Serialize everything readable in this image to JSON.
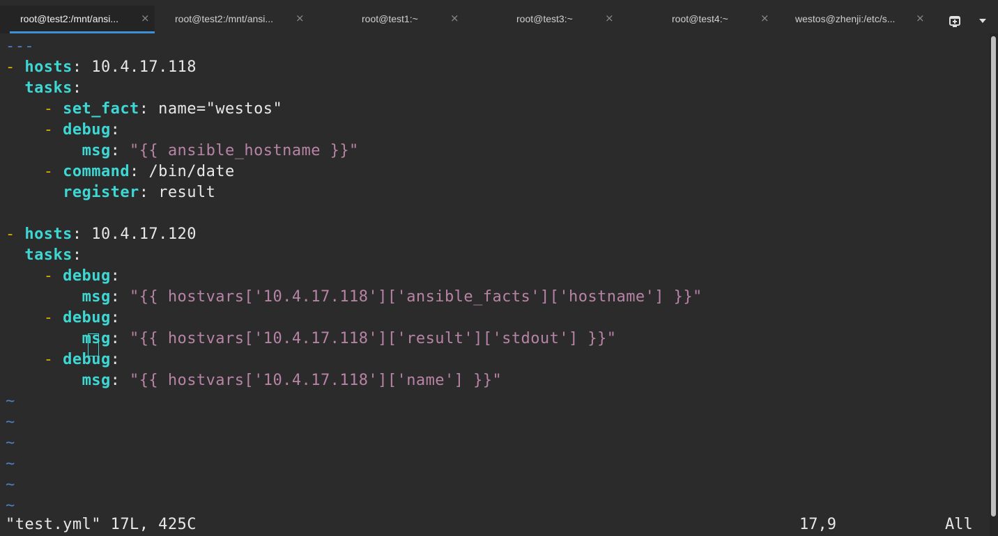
{
  "tabs": [
    {
      "label": "root@test2:/mnt/ansi...",
      "active": true
    },
    {
      "label": "root@test2:/mnt/ansi...",
      "active": false
    },
    {
      "label": "root@test1:~",
      "active": false
    },
    {
      "label": "root@test3:~",
      "active": false
    },
    {
      "label": "root@test4:~",
      "active": false
    },
    {
      "label": "westos@zhenji:/etc/s...",
      "active": false
    }
  ],
  "tab_close_glyph": "×",
  "icons": {
    "new_tab": "new-tab-icon",
    "menu": "chevron-down-icon"
  },
  "colors": {
    "key": "#3ed8d4",
    "dash": "#d7b100",
    "string": "#b884a6",
    "tilde": "#4e7fbf",
    "active_tab_underline": "#3d8fd6"
  },
  "editor": {
    "doc_start": "---",
    "lines": {
      "l2": {
        "dash": "- ",
        "key": "hosts",
        "colon": ": ",
        "value": "10.4.17.118"
      },
      "l3": {
        "indent": "  ",
        "key": "tasks",
        "colon": ":"
      },
      "l4": {
        "indent": "    ",
        "dash": "- ",
        "key": "set_fact",
        "colon": ": ",
        "value": "name=\"westos\""
      },
      "l5": {
        "indent": "    ",
        "dash": "- ",
        "key": "debug",
        "colon": ":"
      },
      "l6": {
        "indent": "        ",
        "key": "msg",
        "colon": ": ",
        "value": "\"{{ ansible_hostname }}\""
      },
      "l7": {
        "indent": "    ",
        "dash": "- ",
        "key": "command",
        "colon": ": ",
        "value": "/bin/date"
      },
      "l8": {
        "indent": "      ",
        "key": "register",
        "colon": ": ",
        "value": "result"
      },
      "l10": {
        "dash": "- ",
        "key": "hosts",
        "colon": ": ",
        "value": "10.4.17.120"
      },
      "l11": {
        "indent": "  ",
        "key": "tasks",
        "colon": ":"
      },
      "l12": {
        "indent": "    ",
        "dash": "- ",
        "key": "debug",
        "colon": ":"
      },
      "l13": {
        "indent": "        ",
        "key": "msg",
        "colon": ": ",
        "value": "\"{{ hostvars['10.4.17.118']['ansible_facts']['hostname'] }}\""
      },
      "l14": {
        "indent": "    ",
        "dash": "- ",
        "key": "debug",
        "colon": ":"
      },
      "l15": {
        "indent": "        ",
        "key": "msg",
        "colon": ": ",
        "value": "\"{{ hostvars['10.4.17.118']['result']['stdout'] }}\""
      },
      "l16": {
        "indent": "    ",
        "dash": "- ",
        "key": "debug",
        "colon": ":"
      },
      "l17": {
        "indent": "        ",
        "key": "msg",
        "colon": ": ",
        "value": "\"{{ hostvars['10.4.17.118']['name'] }}\""
      }
    },
    "empty_marker": "~"
  },
  "status": {
    "file_info": "\"test.yml\" 17L, 425C",
    "cursor_position": "17,9",
    "scroll_position": "All"
  }
}
